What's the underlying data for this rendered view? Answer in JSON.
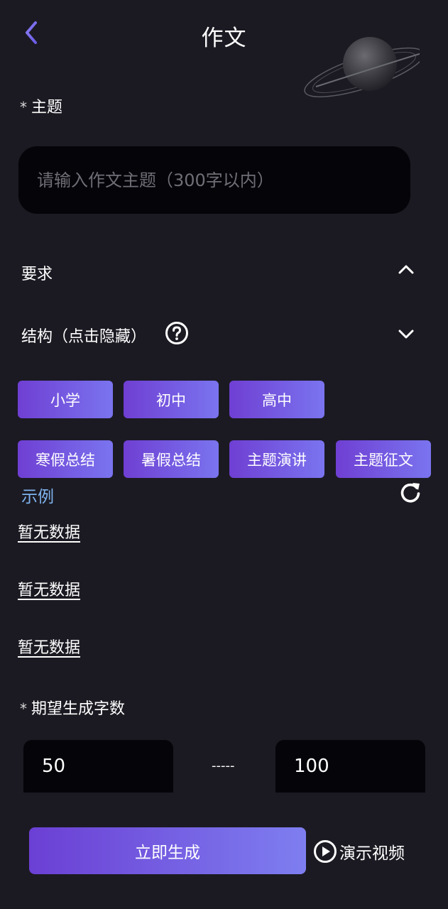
{
  "header": {
    "title": "作文"
  },
  "topic": {
    "required_mark": "*",
    "label": "主题",
    "placeholder": "请输入作文主题（300字以内）"
  },
  "requirements": {
    "label": "要求"
  },
  "structure": {
    "label": "结构（点击隐藏）",
    "chips_row1": [
      "小学",
      "初中",
      "高中"
    ],
    "chips_row2": [
      "寒假总结",
      "暑假总结",
      "主题演讲",
      "主题征文"
    ]
  },
  "examples": {
    "label": "示例",
    "items": [
      "暂无数据",
      "暂无数据",
      "暂无数据"
    ]
  },
  "word_count": {
    "required_mark": "*",
    "label": "期望生成字数",
    "min_value": "50",
    "separator": "-----",
    "max_value": "100"
  },
  "actions": {
    "generate_label": "立即生成",
    "demo_label": "演示视频"
  },
  "colors": {
    "background": "#1b1a22",
    "accent_start": "#6f3fd3",
    "accent_end": "#7a74ef",
    "link": "#7fb4f0"
  }
}
